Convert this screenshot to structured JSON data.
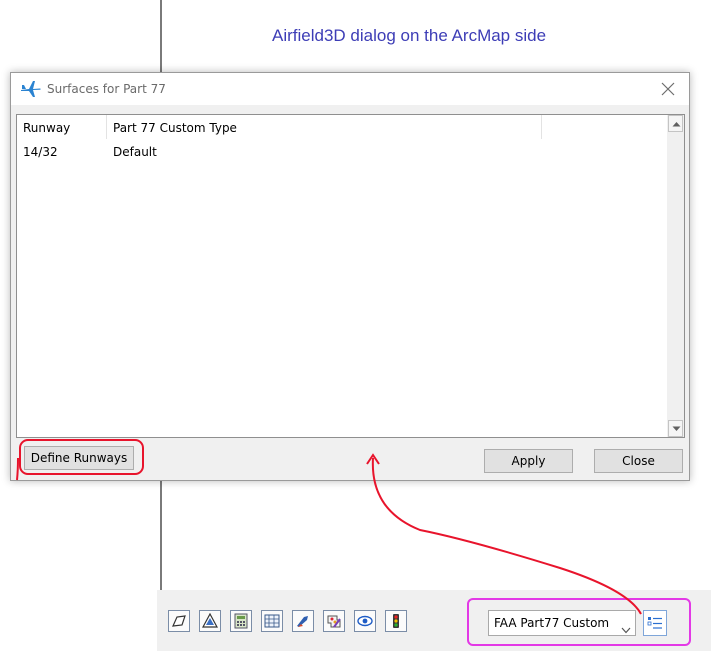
{
  "caption": "Airfield3D dialog on the ArcMap side",
  "dialog": {
    "title": "Surfaces for Part 77",
    "columns": [
      "Runway",
      "Part 77 Custom Type"
    ],
    "rows": [
      {
        "runway": "14/32",
        "type": "Default"
      }
    ],
    "buttons": {
      "define_runways": "Define Runways",
      "apply": "Apply",
      "close": "Close"
    }
  },
  "toolbar": {
    "icons": [
      "sketch-tool-icon",
      "triangle-surface-icon",
      "calculator-icon",
      "data-grid-icon",
      "airplane-paint-icon",
      "palette-icon",
      "eye-icon",
      "traffic-light-icon"
    ],
    "combo_value": "FAA Part77 Custom",
    "list_button_icon": "list-icon"
  },
  "colors": {
    "caption": "#3d3db6",
    "highlight_red": "#e8142c",
    "highlight_magenta": "#e339e6"
  }
}
